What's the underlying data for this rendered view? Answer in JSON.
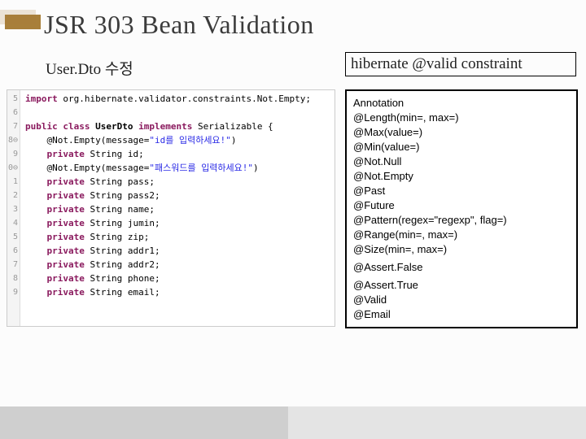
{
  "title": "JSR 303 Bean Validation",
  "subtitle_left": "User.Dto 수정",
  "subtitle_right": "hibernate @valid constraint",
  "code_gutter": [
    "5",
    "6",
    "7",
    "8⊖",
    "9",
    "0⊖",
    "1",
    "2",
    "3",
    "4",
    "5",
    "6",
    "7",
    "8",
    "9"
  ],
  "code": {
    "l1_kw": "import",
    "l1_rest": " org.hibernate.validator.constraints.Not.Empty;",
    "l3_kw_public": "public",
    "l3_kw_class": "class",
    "l3_name": "UserDto",
    "l3_kw_impl": "implements",
    "l3_iface": "Serializable {",
    "ann1": "@Not.Empty(message=",
    "ann1_str": "\"id를 입력하세요!\"",
    "ann1_end": ")",
    "f_private": "private",
    "f_string": "String",
    "f_id": "id;",
    "ann2": "@Not.Empty(message=",
    "ann2_str": "\"패스워드를 입력하세요!\"",
    "ann2_end": ")",
    "f_pass": "pass;",
    "f_pass2": "pass2;",
    "f_name": "name;",
    "f_jumin": "jumin;",
    "f_zip": "zip;",
    "f_addr1": "addr1;",
    "f_addr2": "addr2;",
    "f_phone": "phone;",
    "f_email": "email;"
  },
  "annotations": [
    "Annotation",
    "@Length(min=, max=)",
    "@Max(value=)",
    "@Min(value=)",
    "@Not.Null",
    "@Not.Empty",
    "@Past",
    "@Future",
    "@Pattern(regex=\"regexp\", flag=)",
    "@Range(min=, max=)",
    "@Size(min=, max=)",
    "@Assert.False",
    "@Assert.True",
    "@Valid",
    "@Email"
  ]
}
